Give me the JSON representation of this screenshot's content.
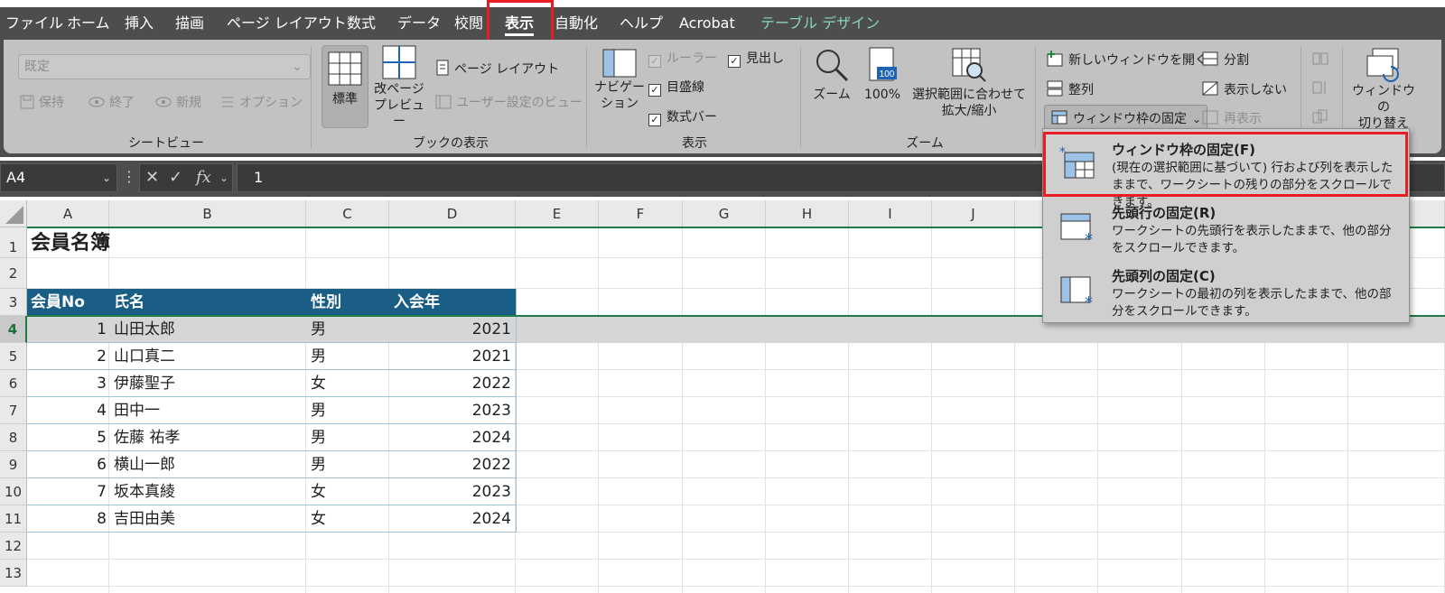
{
  "tabs": [
    {
      "label": "ファイル"
    },
    {
      "label": "ホーム"
    },
    {
      "label": "挿入"
    },
    {
      "label": "描画"
    },
    {
      "label": "ページ レイアウト"
    },
    {
      "label": "数式"
    },
    {
      "label": "データ"
    },
    {
      "label": "校閲"
    },
    {
      "label": "表示"
    },
    {
      "label": "自動化"
    },
    {
      "label": "ヘルプ"
    },
    {
      "label": "Acrobat"
    },
    {
      "label": "テーブル デザイン"
    }
  ],
  "ribbon": {
    "sheetview": {
      "combo_value": "既定",
      "keep": "保持",
      "exit": "終了",
      "new": "新規",
      "options": "オプション",
      "group": "シートビュー"
    },
    "bookview": {
      "normal": "標準",
      "pagebreak": "改ページ\nプレビュー",
      "pagelayout": "ページ レイアウト",
      "custom": "ユーザー設定のビュー",
      "group": "ブックの表示"
    },
    "show": {
      "navigation": "ナビゲー\nション",
      "ruler": "ルーラー",
      "gridlines": "目盛線",
      "formulabar": "数式バー",
      "headings": "見出し",
      "group": "表示"
    },
    "zoom": {
      "zoom": "ズーム",
      "hundred": "100%",
      "fit": "選択範囲に合わせて\n拡大/縮小",
      "group": "ズーム"
    },
    "window": {
      "newwindow": "新しいウィンドウを開く",
      "arrange": "整列",
      "freeze": "ウィンドウ枠の固定",
      "split": "分割",
      "hide": "表示しない",
      "unhide": "再表示",
      "switch": "ウィンドウの\n切り替え"
    }
  },
  "formula_bar": {
    "namebox": "A4",
    "fx": "fx",
    "value": "1"
  },
  "columns": [
    "A",
    "B",
    "C",
    "D",
    "E",
    "F",
    "G",
    "H",
    "I",
    "J"
  ],
  "rows": [
    "1",
    "2",
    "3",
    "4",
    "5",
    "6",
    "7",
    "8",
    "9",
    "10",
    "11",
    "12",
    "13"
  ],
  "sheet": {
    "title": "会員名簿",
    "headers": [
      "会員No",
      "氏名",
      "性別",
      "入会年"
    ],
    "records": [
      {
        "no": "1",
        "name": "山田太郎",
        "sex": "男",
        "year": "2021"
      },
      {
        "no": "2",
        "name": "山口真二",
        "sex": "男",
        "year": "2021"
      },
      {
        "no": "3",
        "name": "伊藤聖子",
        "sex": "女",
        "year": "2022"
      },
      {
        "no": "4",
        "name": "田中一",
        "sex": "男",
        "year": "2023"
      },
      {
        "no": "5",
        "name": "佐藤 祐孝",
        "sex": "男",
        "year": "2024"
      },
      {
        "no": "6",
        "name": "横山一郎",
        "sex": "男",
        "year": "2022"
      },
      {
        "no": "7",
        "name": "坂本真綾",
        "sex": "女",
        "year": "2023"
      },
      {
        "no": "8",
        "name": "吉田由美",
        "sex": "女",
        "year": "2024"
      }
    ]
  },
  "freeze_menu": [
    {
      "title": "ウィンドウ枠の固定(F)",
      "desc": "(現在の選択範囲に基づいて) 行および列を表示したままで、ワークシートの残りの部分をスクロールできます。"
    },
    {
      "title": "先頭行の固定(R)",
      "desc": "ワークシートの先頭行を表示したままで、他の部分をスクロールできます。"
    },
    {
      "title": "先頭列の固定(C)",
      "desc": "ワークシートの最初の列を表示したままで、他の部分をスクロールできます。"
    }
  ],
  "colors": {
    "accent": "#e81c23",
    "table_header": "#1b5e85",
    "freeze_line": "#1f7a44"
  }
}
